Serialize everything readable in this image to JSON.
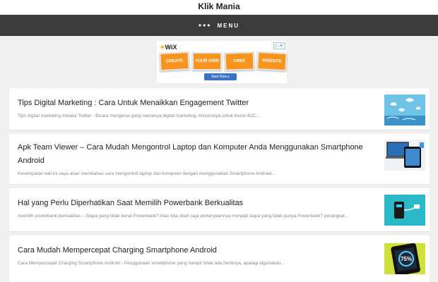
{
  "header": {
    "site_title": "Klik Mania"
  },
  "menu": {
    "label": "MENU"
  },
  "ad": {
    "brand": "WiX",
    "tiles": [
      "CREATE",
      "YOUR OWN",
      "FREE",
      "WEBSITE"
    ],
    "cta": "Start Now ▸"
  },
  "posts": [
    {
      "title": "Tips Digital Marketing : Cara Untuk Menaikkan Engagement Twitter",
      "excerpt": "Tips digital marketing melalui Twitter - Bicara mengenai yang namanya digital marketing, khususnya untuk bisnis B2C...",
      "thumb_icon": "twitter-birds-icon"
    },
    {
      "title": "Apk Team Viewer – Cara Mudah Mengontrol Laptop dan Komputer Anda Menggunakan Smartphone Android",
      "excerpt": "Kesempatan kali ini saya akan membahas cara mengontrol laptop dan komputer dengan menggunakan Smartphone Android...",
      "thumb_icon": "devices-icon"
    },
    {
      "title": "Hal yang Perlu Diperhatikan Saat Memilih Powerbank Berkualitas",
      "excerpt": "memilih powerbank berkualitas – Siapa yang tidak kenal Powerbank? Atau kita ubah saja pertanyaannya menjadi siapa yang tidak punya Powerbank? perangkat...",
      "thumb_icon": "powerbank-icon"
    },
    {
      "title": "Cara Mudah Mempercepat Charging Smartphone Android",
      "excerpt": "Cara Mempercepat Charging Smartphone Android - Penggunaan smartphone yang hampir tidak ada hentinya, apalagi digunakan...",
      "thumb_icon": "battery-phone-icon",
      "thumb_text": "75%"
    }
  ]
}
